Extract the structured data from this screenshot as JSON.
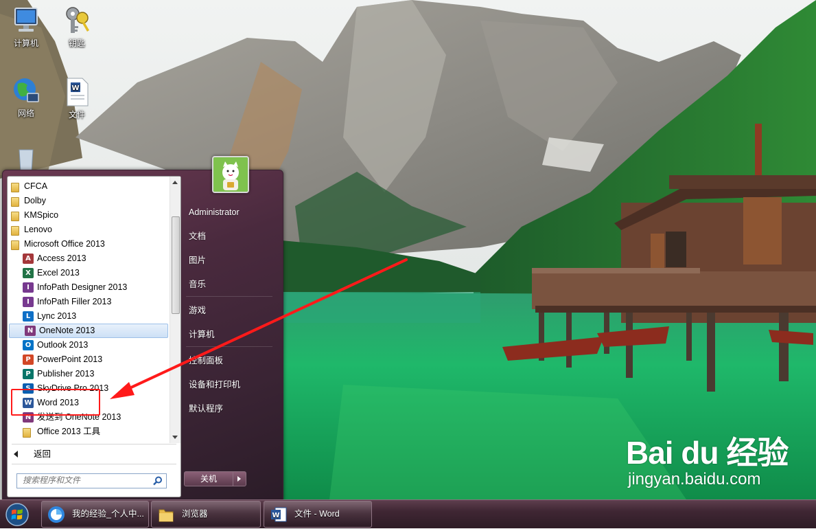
{
  "desktop": {
    "icons": [
      {
        "label": "计算机"
      },
      {
        "label": "钥匙"
      },
      {
        "label": "网络"
      },
      {
        "label": "文件"
      }
    ]
  },
  "start_menu": {
    "programs": [
      {
        "label": "CFCA",
        "type": "folder"
      },
      {
        "label": "Dolby",
        "type": "folder"
      },
      {
        "label": "KMSpico",
        "type": "folder"
      },
      {
        "label": "Lenovo",
        "type": "folder"
      },
      {
        "label": "Microsoft Office 2013",
        "type": "folder"
      },
      {
        "label": "Access 2013",
        "type": "app",
        "icon": "access-icon",
        "color": "#a4373a",
        "glyph": "A"
      },
      {
        "label": "Excel 2013",
        "type": "app",
        "icon": "excel-icon",
        "color": "#217346",
        "glyph": "X"
      },
      {
        "label": "InfoPath Designer 2013",
        "type": "app",
        "icon": "infopath-icon",
        "color": "#77398f",
        "glyph": "I"
      },
      {
        "label": "InfoPath Filler 2013",
        "type": "app",
        "icon": "infopath-icon",
        "color": "#77398f",
        "glyph": "I"
      },
      {
        "label": "Lync 2013",
        "type": "app",
        "icon": "lync-icon",
        "color": "#0f6fc6",
        "glyph": "L"
      },
      {
        "label": "OneNote 2013",
        "type": "app",
        "icon": "onenote-icon",
        "color": "#80397b",
        "glyph": "N",
        "selected": true
      },
      {
        "label": "Outlook 2013",
        "type": "app",
        "icon": "outlook-icon",
        "color": "#0072c6",
        "glyph": "O"
      },
      {
        "label": "PowerPoint 2013",
        "type": "app",
        "icon": "powerpoint-icon",
        "color": "#d24726",
        "glyph": "P"
      },
      {
        "label": "Publisher 2013",
        "type": "app",
        "icon": "publisher-icon",
        "color": "#077568",
        "glyph": "P"
      },
      {
        "label": "SkyDrive Pro 2013",
        "type": "app",
        "icon": "skydrive-icon",
        "color": "#0a5fb0",
        "glyph": "S"
      },
      {
        "label": "Word 2013",
        "type": "app",
        "icon": "word-icon",
        "color": "#2b579a",
        "glyph": "W"
      },
      {
        "label": "发送到 OneNote 2013",
        "type": "app",
        "icon": "onenote-send-icon",
        "color": "#80397b",
        "glyph": "N"
      },
      {
        "label": "Office 2013 工具",
        "type": "subfolder",
        "icon": "folder-icon",
        "color": "#e1b23f",
        "glyph": ""
      }
    ],
    "back_label": "返回",
    "search_placeholder": "搜索程序和文件",
    "user_name": "Administrator",
    "right_items": [
      "文档",
      "图片",
      "音乐",
      "游戏",
      "计算机",
      "控制面板",
      "设备和打印机",
      "默认程序"
    ],
    "shutdown_label": "关机"
  },
  "taskbar": {
    "buttons": [
      {
        "label": "我的经验_个人中...",
        "icon": "browser-icon"
      },
      {
        "label": "浏览器",
        "icon": "folder-icon"
      },
      {
        "label": "文件 - Word",
        "icon": "word-icon"
      }
    ]
  },
  "watermark": {
    "logo": "Bai du 经验",
    "sub": "jingyan.baidu.com"
  },
  "colors": {
    "annotation_red": "#ff1a1a",
    "menu_bg": "#4a2a3e",
    "selection": "#cde0f6"
  }
}
